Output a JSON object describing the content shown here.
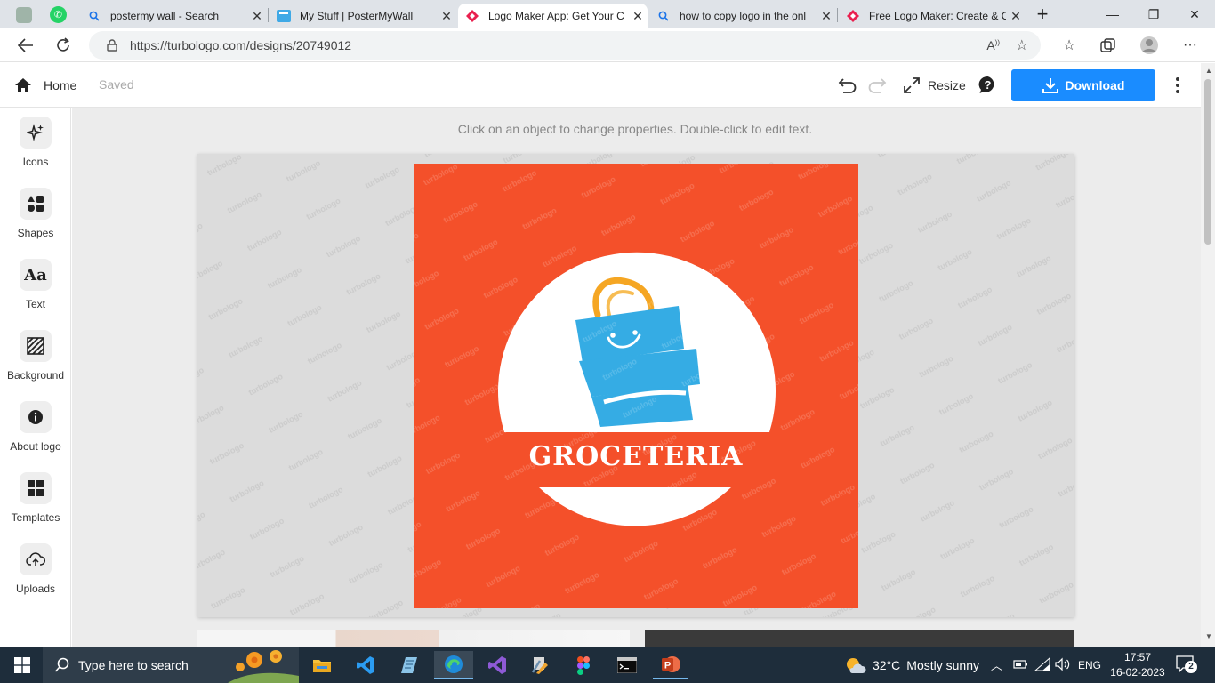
{
  "browser": {
    "tabs": [
      {
        "title": "postermy wall - Search",
        "icon": "search-icon"
      },
      {
        "title": "My Stuff | PosterMyWall",
        "icon": "postermywall-icon"
      },
      {
        "title": "Logo Maker App: Get Your C",
        "icon": "turbologo-icon",
        "active": true
      },
      {
        "title": "how to copy logo in the onl",
        "icon": "search-icon"
      },
      {
        "title": "Free Logo Maker: Create & C",
        "icon": "turbologo-icon"
      }
    ],
    "url": "https://turbologo.com/designs/20749012"
  },
  "app": {
    "home_label": "Home",
    "saved_label": "Saved",
    "resize_label": "Resize",
    "download_label": "Download",
    "hint": "Click on an object to change properties. Double-click to edit text.",
    "accent": "#1a8cff",
    "sidebar": [
      {
        "label": "Icons",
        "icon": "sparkle-icon"
      },
      {
        "label": "Shapes",
        "icon": "shapes-icon"
      },
      {
        "label": "Text",
        "icon": "text-icon",
        "glyph": "Aa"
      },
      {
        "label": "Background",
        "icon": "background-pattern-icon"
      },
      {
        "label": "About logo",
        "icon": "info-icon"
      },
      {
        "label": "Templates",
        "icon": "templates-icon"
      },
      {
        "label": "Uploads",
        "icon": "upload-cloud-icon"
      }
    ]
  },
  "logo": {
    "brand_name": "GROCETERIA",
    "background_color": "#f4502a",
    "bag_color": "#35ace4",
    "handle_color": "#f5a623",
    "watermark": "turbologo"
  },
  "taskbar": {
    "search_placeholder": "Type here to search",
    "weather_temp": "32°C",
    "weather_desc": "Mostly sunny",
    "language": "ENG",
    "time": "17:57",
    "date": "16-02-2023",
    "notification_count": "2"
  }
}
